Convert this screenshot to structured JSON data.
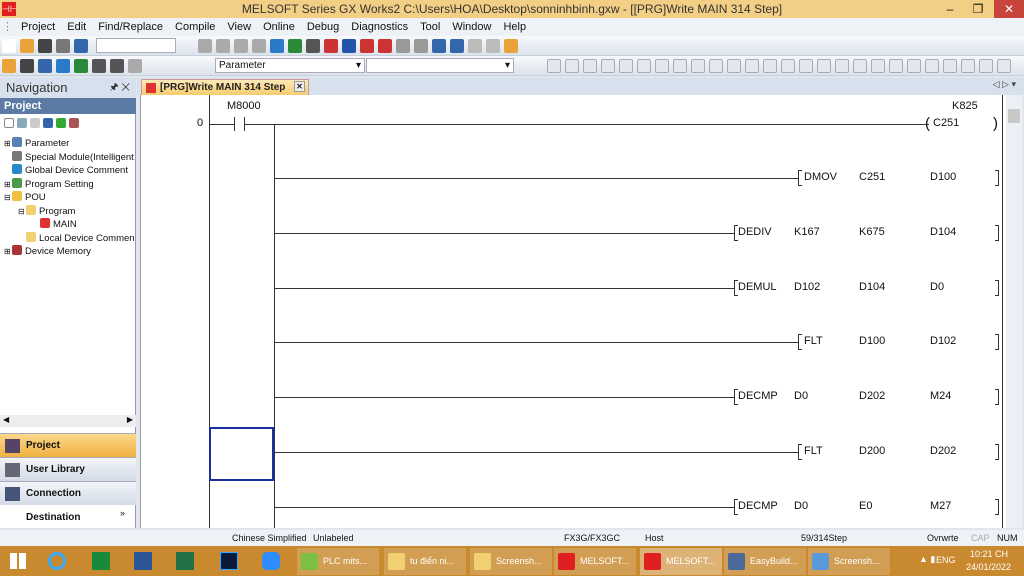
{
  "window": {
    "title": "MELSOFT Series GX Works2 C:\\Users\\HOA\\Desktop\\sonninhbinh.gxw - [[PRG]Write MAIN 314 Step]"
  },
  "menu": [
    "Project",
    "Edit",
    "Find/Replace",
    "Compile",
    "View",
    "Online",
    "Debug",
    "Diagnostics",
    "Tool",
    "Window",
    "Help"
  ],
  "toolbar": {
    "combo_value": "Parameter"
  },
  "navigation": {
    "title": "Navigation",
    "section": "Project",
    "tree": [
      {
        "label": "Parameter",
        "level": 0
      },
      {
        "label": "Special Module(Intelligent",
        "level": 0
      },
      {
        "label": "Global Device Comment",
        "level": 0
      },
      {
        "label": "Program Setting",
        "level": 0
      },
      {
        "label": "POU",
        "level": 0
      },
      {
        "label": "Program",
        "level": 1
      },
      {
        "label": "MAIN",
        "level": 2
      },
      {
        "label": "Local Device Commen",
        "level": 1
      },
      {
        "label": "Device Memory",
        "level": 0
      }
    ],
    "buttons": [
      "Project",
      "User Library",
      "Connection Destination"
    ]
  },
  "tab": {
    "label": "[PRG]Write MAIN 314 Step"
  },
  "ladder": {
    "step": "0",
    "contact": "M8000",
    "coil": {
      "device": "C251",
      "setting": "K825"
    },
    "instructions": [
      {
        "op": "DMOV",
        "args": [
          "C251",
          "D100"
        ]
      },
      {
        "op": "DEDIV",
        "args": [
          "K167",
          "K675",
          "D104"
        ]
      },
      {
        "op": "DEMUL",
        "args": [
          "D102",
          "D104",
          "D0"
        ]
      },
      {
        "op": "FLT",
        "args": [
          "D100",
          "D102"
        ]
      },
      {
        "op": "DECMP",
        "args": [
          "D0",
          "D202",
          "M24"
        ]
      },
      {
        "op": "FLT",
        "args": [
          "D200",
          "D202"
        ]
      },
      {
        "op": "DECMP",
        "args": [
          "D0",
          "E0",
          "M27"
        ]
      }
    ]
  },
  "status": {
    "language": "Chinese Simplified",
    "label": "Unlabeled",
    "plc": "FX3G/FX3GC",
    "connection": "Host",
    "step": "59/314Step",
    "mode": "Ovrwrte",
    "cap": "CAP",
    "num": "NUM"
  },
  "taskbar": {
    "items": [
      "PLC mits...",
      "tu điển ni...",
      "Screensh...",
      "MELSOFT...",
      "MELSOFT...",
      "EasyBuild...",
      "Screensh..."
    ],
    "lang": "ENG",
    "time": "10:21 CH",
    "date": "24/01/2022"
  }
}
